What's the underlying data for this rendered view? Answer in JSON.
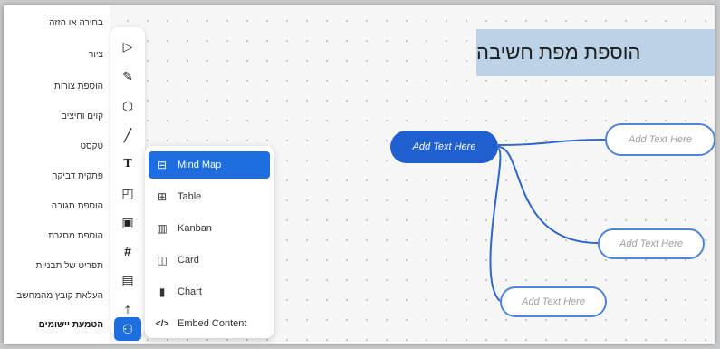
{
  "sidebar_labels": [
    "בחירה או הזזה",
    "ציור",
    "הוספת צורות",
    "קוים וחיצים",
    "טקסט",
    "פתקית דביקה",
    "הוספת תגובה",
    "הוספת מסגרת",
    "תפריט של תבניות",
    "העלאת קובץ מהמחשב",
    "הטמעת יישומים"
  ],
  "toolbar": {
    "tools": [
      {
        "name": "pointer-icon",
        "glyph": "▷"
      },
      {
        "name": "pen-icon",
        "glyph": "✎"
      },
      {
        "name": "shapes-icon",
        "glyph": "⬡"
      },
      {
        "name": "line-icon",
        "glyph": "╱"
      },
      {
        "name": "text-icon",
        "glyph": "T"
      },
      {
        "name": "sticky-note-icon",
        "glyph": "◰"
      },
      {
        "name": "comment-icon",
        "glyph": "▣"
      },
      {
        "name": "frame-icon",
        "glyph": "#"
      },
      {
        "name": "templates-icon",
        "glyph": "▤"
      },
      {
        "name": "upload-icon",
        "glyph": "⤒"
      },
      {
        "name": "embed-apps-icon",
        "glyph": "⚇"
      }
    ]
  },
  "embed_menu": {
    "items": [
      {
        "label": "Mind Map",
        "icon": "mind-map-icon",
        "glyph": "⊟"
      },
      {
        "label": "Table",
        "icon": "table-icon",
        "glyph": "⊞"
      },
      {
        "label": "Kanban",
        "icon": "kanban-icon",
        "glyph": "▥"
      },
      {
        "label": "Card",
        "icon": "card-icon",
        "glyph": "◫"
      },
      {
        "label": "Chart",
        "icon": "chart-icon",
        "glyph": "▮"
      },
      {
        "label": "Embed Content",
        "icon": "embed-code-icon",
        "glyph": "</>"
      }
    ]
  },
  "banner": {
    "text": "הוספת מפת חשיבה"
  },
  "mindmap": {
    "root": "Add Text Here",
    "children": [
      "Add Text Here",
      "Add Text Here",
      "Add Text Here"
    ]
  },
  "colors": {
    "accent": "#1f6ee0",
    "root_node": "#1f5fcf",
    "banner": "#bcd3e7",
    "edge": "#2f66c9"
  }
}
